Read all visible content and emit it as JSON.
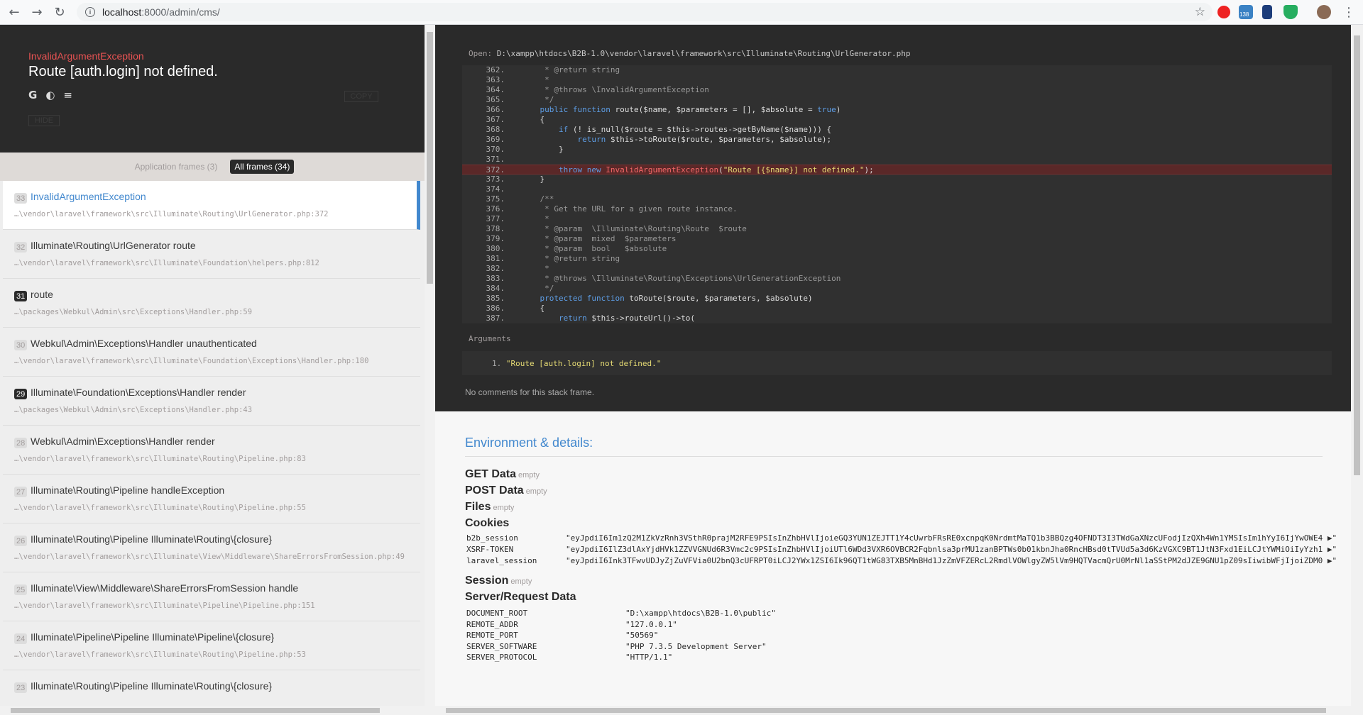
{
  "browser": {
    "url_host": "localhost",
    "url_rest": ":8000/admin/cms/",
    "back_icon": "arrow-left",
    "forward_icon": "arrow-right",
    "reload_icon": "reload",
    "ext_badge": "138"
  },
  "exception": {
    "class": "InvalidArgumentException",
    "message": "Route [auth.login] not defined.",
    "copy_label": "COPY",
    "hide_label": "HIDE"
  },
  "filters": {
    "application": "Application frames (3)",
    "all": "All frames (34)"
  },
  "frames": [
    {
      "num": "33",
      "title": "InvalidArgumentException",
      "file": "…\\vendor\\laravel\\framework\\src\\Illuminate\\Routing\\UrlGenerator.php:372"
    },
    {
      "num": "32",
      "title": "Illuminate\\Routing\\UrlGenerator route",
      "file": "…\\vendor\\laravel\\framework\\src\\Illuminate\\Foundation\\helpers.php:812"
    },
    {
      "num": "31",
      "title": "route",
      "file": "…\\packages\\Webkul\\Admin\\src\\Exceptions\\Handler.php:59"
    },
    {
      "num": "30",
      "title": "Webkul\\Admin\\Exceptions\\Handler unauthenticated",
      "file": "…\\vendor\\laravel\\framework\\src\\Illuminate\\Foundation\\Exceptions\\Handler.php:180"
    },
    {
      "num": "29",
      "title": "Illuminate\\Foundation\\Exceptions\\Handler render",
      "file": "…\\packages\\Webkul\\Admin\\src\\Exceptions\\Handler.php:43"
    },
    {
      "num": "28",
      "title": "Webkul\\Admin\\Exceptions\\Handler render",
      "file": "…\\vendor\\laravel\\framework\\src\\Illuminate\\Routing\\Pipeline.php:83"
    },
    {
      "num": "27",
      "title": "Illuminate\\Routing\\Pipeline handleException",
      "file": "…\\vendor\\laravel\\framework\\src\\Illuminate\\Routing\\Pipeline.php:55"
    },
    {
      "num": "26",
      "title": "Illuminate\\Routing\\Pipeline Illuminate\\Routing\\{closure}",
      "file": "…\\vendor\\laravel\\framework\\src\\Illuminate\\View\\Middleware\\ShareErrorsFromSession.php:49"
    },
    {
      "num": "25",
      "title": "Illuminate\\View\\Middleware\\ShareErrorsFromSession handle",
      "file": "…\\vendor\\laravel\\framework\\src\\Illuminate\\Pipeline\\Pipeline.php:151"
    },
    {
      "num": "24",
      "title": "Illuminate\\Pipeline\\Pipeline Illuminate\\Pipeline\\{closure}",
      "file": "…\\vendor\\laravel\\framework\\src\\Illuminate\\Routing\\Pipeline.php:53"
    },
    {
      "num": "23",
      "title": "Illuminate\\Routing\\Pipeline Illuminate\\Routing\\{closure}",
      "file": ""
    }
  ],
  "code": {
    "open_label": "Open:",
    "path": "D:\\xampp\\htdocs\\B2B-1.0\\vendor\\laravel\\framework\\src\\Illuminate\\Routing\\UrlGenerator.php",
    "lines": [
      {
        "n": "362.",
        "html": "<span class=\"cm\">     * @return string</span>"
      },
      {
        "n": "363.",
        "html": "<span class=\"cm\">     *</span>"
      },
      {
        "n": "364.",
        "html": "<span class=\"cm\">     * @throws \\InvalidArgumentException</span>"
      },
      {
        "n": "365.",
        "html": "<span class=\"cm\">     */</span>"
      },
      {
        "n": "366.",
        "html": "    <span class=\"kw\">public function</span> route($name, $parameters = [], $absolute = <span class=\"kw\">true</span>)"
      },
      {
        "n": "367.",
        "html": "    {"
      },
      {
        "n": "368.",
        "html": "        <span class=\"kw\">if</span> (! is_null($route = $this->routes->getByName($name))) {"
      },
      {
        "n": "369.",
        "html": "            <span class=\"kw\">return</span> $this->toRoute($route, $parameters, $absolute);"
      },
      {
        "n": "370.",
        "html": "        }"
      },
      {
        "n": "371.",
        "html": ""
      },
      {
        "n": "372.",
        "html": "        <span class=\"kw\">throw new</span> <span class=\"red\">InvalidArgumentException</span>(<span class=\"str\">\"Route [{$name}] not defined.\"</span>);",
        "hl": true
      },
      {
        "n": "373.",
        "html": "    }"
      },
      {
        "n": "374.",
        "html": ""
      },
      {
        "n": "375.",
        "html": "<span class=\"cm\">    /**</span>"
      },
      {
        "n": "376.",
        "html": "<span class=\"cm\">     * Get the URL for a given route instance.</span>"
      },
      {
        "n": "377.",
        "html": "<span class=\"cm\">     *</span>"
      },
      {
        "n": "378.",
        "html": "<span class=\"cm\">     * @param  \\Illuminate\\Routing\\Route  $route</span>"
      },
      {
        "n": "379.",
        "html": "<span class=\"cm\">     * @param  mixed  $parameters</span>"
      },
      {
        "n": "380.",
        "html": "<span class=\"cm\">     * @param  bool   $absolute</span>"
      },
      {
        "n": "381.",
        "html": "<span class=\"cm\">     * @return string</span>"
      },
      {
        "n": "382.",
        "html": "<span class=\"cm\">     *</span>"
      },
      {
        "n": "383.",
        "html": "<span class=\"cm\">     * @throws \\Illuminate\\Routing\\Exceptions\\UrlGenerationException</span>"
      },
      {
        "n": "384.",
        "html": "<span class=\"cm\">     */</span>"
      },
      {
        "n": "385.",
        "html": "    <span class=\"kw\">protected function</span> toRoute($route, $parameters, $absolute)"
      },
      {
        "n": "386.",
        "html": "    {"
      },
      {
        "n": "387.",
        "html": "        <span class=\"kw\">return</span> $this->routeUrl()->to("
      }
    ],
    "arguments_label": "Arguments",
    "argument_index": "1.",
    "argument_value": "\"Route [auth.login] not defined.\"",
    "no_comments": "No comments for this stack frame."
  },
  "details": {
    "title": "Environment & details:",
    "empty": "empty",
    "get": "GET Data",
    "post": "POST Data",
    "files": "Files",
    "cookies": "Cookies",
    "session": "Session",
    "server": "Server/Request Data",
    "cookie_rows": [
      {
        "k": "b2b_session",
        "v": "\"eyJpdiI6Im1zQ2M1ZkVzRnh3VSthR0prajM2RFE9PSIsInZhbHVlIjoieGQ3YUN1ZEJTT1Y4cUwrbFRsRE0xcnpqK0NrdmtMaTQ1b3BBQzg4OFNDT3I3TWdGaXNzcUFodjIzQXh4Wn1YMSIsIm1hYyI6IjYwOWE4 ▶\""
      },
      {
        "k": "XSRF-TOKEN",
        "v": "\"eyJpdiI6IlZ3dlAxYjdHVk1ZZVVGNUd6R3Vmc2c9PSIsInZhbHVlIjoiUTl6WDd3VXR6OVBCR2Fqbnlsa3prMU1zanBPTWs0b01kbnJha0RncHBsd0tTVUd5a3d6KzVGXC9BT1JtN3Fxd1EiLCJtYWMiOiIyYzh1 ▶\""
      },
      {
        "k": "laravel_session",
        "v": "\"eyJpdiI6Ink3TFwvUDJyZjZuVFVia0U2bnQ3cUFRPT0iLCJ2YWx1ZSI6Ik96QT1tWG83TXB5MnBHd1JzZmVFZERcL2RmdlVOWlgyZW5lVm9HQTVacmQrU0MrNl1aSStPM2dJZE9GNU1pZ09sIiwibWFjIjoiZDM0 ▶\""
      }
    ],
    "server_rows": [
      {
        "k": "DOCUMENT_ROOT",
        "v": "\"D:\\xampp\\htdocs\\B2B-1.0\\public\""
      },
      {
        "k": "REMOTE_ADDR",
        "v": "\"127.0.0.1\""
      },
      {
        "k": "REMOTE_PORT",
        "v": "\"50569\""
      },
      {
        "k": "SERVER_SOFTWARE",
        "v": "\"PHP 7.3.5 Development Server\""
      },
      {
        "k": "SERVER_PROTOCOL",
        "v": "\"HTTP/1.1\""
      }
    ]
  }
}
